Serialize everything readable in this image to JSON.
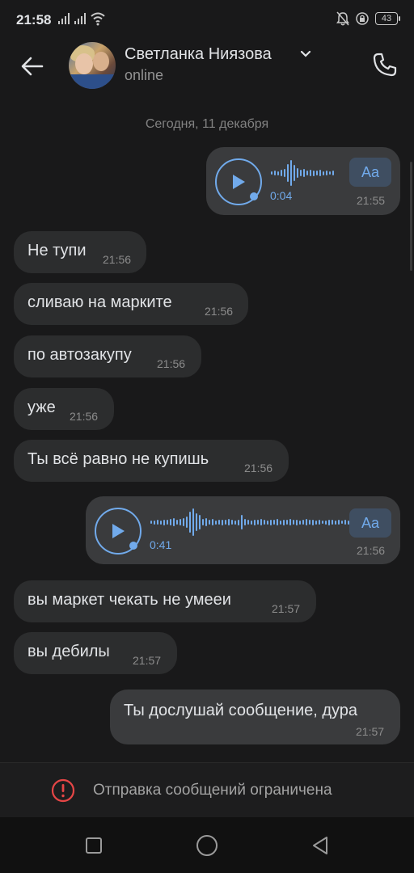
{
  "status_bar": {
    "time": "21:58",
    "battery": "43"
  },
  "header": {
    "name": "Светланка Ниязова",
    "status": "online"
  },
  "date_separator": "Сегодня, 11 декабря",
  "voice_messages": [
    {
      "duration": "0:04",
      "time": "21:55",
      "aa_label": "Aa"
    },
    {
      "duration": "0:41",
      "time": "21:56",
      "aa_label": "Aa"
    }
  ],
  "messages": [
    {
      "text": "Не тупи",
      "time": "21:56"
    },
    {
      "text": "сливаю на марките",
      "time": "21:56"
    },
    {
      "text": "по автозакупу",
      "time": "21:56"
    },
    {
      "text": "уже",
      "time": "21:56"
    },
    {
      "text": "Ты всё равно не купишь",
      "time": "21:56"
    },
    {
      "text": "вы маркет чекать не умееи",
      "time": "21:57"
    },
    {
      "text": "вы дебилы",
      "time": "21:57"
    },
    {
      "text": "Ты дослушай сообщение, дура",
      "time": "21:57"
    }
  ],
  "restriction": {
    "text": "Отправка сообщений ограничена"
  },
  "colors": {
    "accent": "#71aaeb",
    "background": "#19191a",
    "incoming": "#2c2d2e",
    "outgoing": "#3a3b3d",
    "error": "#e64646"
  }
}
